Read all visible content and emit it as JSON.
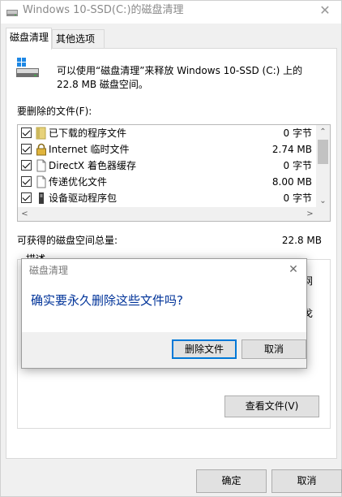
{
  "window": {
    "title": "Windows 10-SSD(C:)的磁盘清理",
    "close_glyph": "✕"
  },
  "tabs": [
    {
      "label": "磁盘清理",
      "active": true
    },
    {
      "label": "其他选项",
      "active": false
    }
  ],
  "intro": {
    "text": "可以使用“磁盘清理”来释放 Windows 10-SSD (C:) 上的 22.8 MB 磁盘空间。"
  },
  "files": {
    "label": "要删除的文件(F):",
    "items": [
      {
        "name": "已下载的程序文件",
        "size": "0 字节",
        "checked": true,
        "icon": "folder-icon"
      },
      {
        "name": "Internet 临时文件",
        "size": "2.74 MB",
        "checked": true,
        "icon": "lock-icon"
      },
      {
        "name": "DirectX 着色器缓存",
        "size": "0 字节",
        "checked": true,
        "icon": "document-icon"
      },
      {
        "name": "传递优化文件",
        "size": "8.00 MB",
        "checked": true,
        "icon": "document-icon"
      },
      {
        "name": "设备驱动程序包",
        "size": "0 字节",
        "checked": true,
        "icon": "device-icon"
      }
    ]
  },
  "scroll": {
    "up": "⌃",
    "down": "⌄",
    "left": "<",
    "right": ">"
  },
  "total": {
    "label": "可获得的磁盘空间总量:",
    "value": "22.8 MB"
  },
  "description": {
    "legend": "描述",
    "visible_text": "网\n\n戈"
  },
  "buttons": {
    "view_files": "查看文件(V)",
    "ok": "确定",
    "cancel": "取消"
  },
  "dialog": {
    "title": "磁盘清理",
    "close_glyph": "✕",
    "message": "确实要永久删除这些文件吗?",
    "delete_label": "删除文件",
    "cancel_label": "取消"
  },
  "colors": {
    "accent": "#0078d7",
    "message_text": "#003399",
    "folder_icon": "#e7d27a"
  }
}
